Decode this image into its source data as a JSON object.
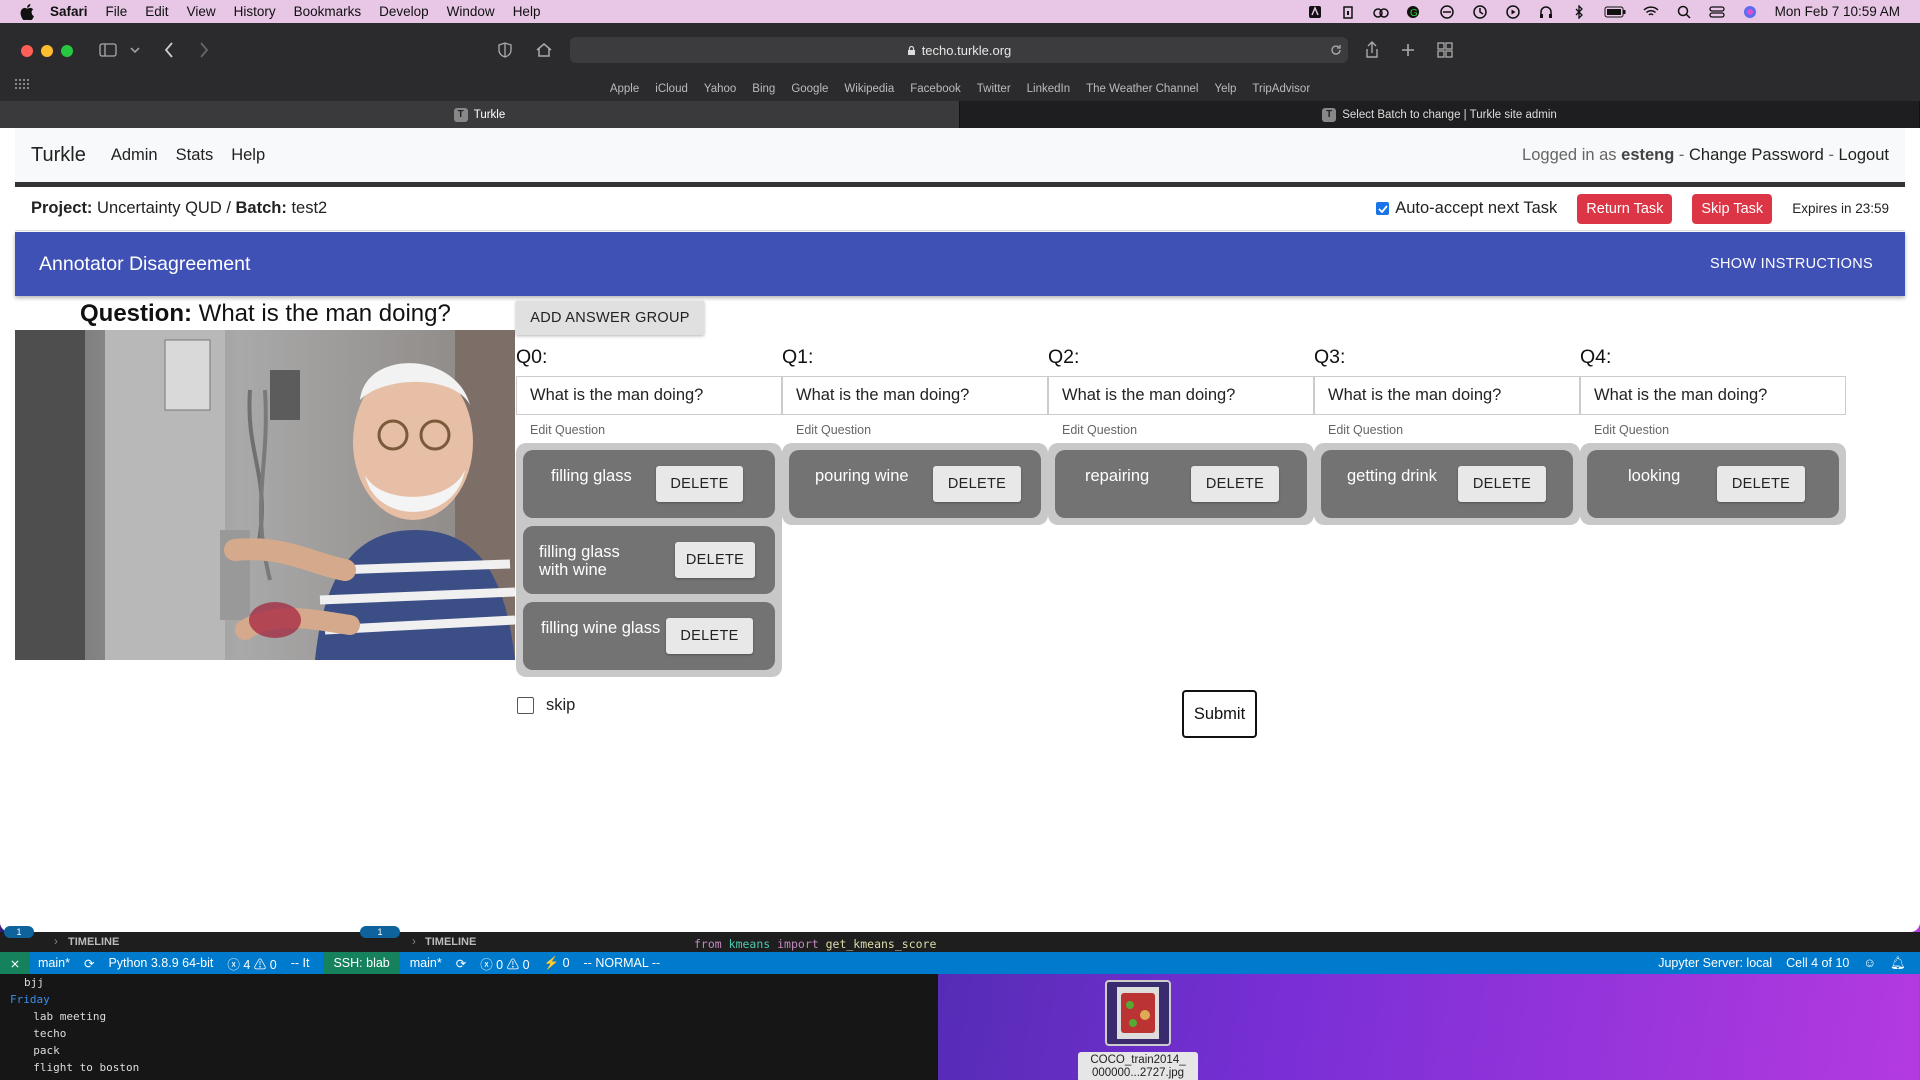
{
  "menubar": {
    "app": "Safari",
    "items": [
      "File",
      "Edit",
      "View",
      "History",
      "Bookmarks",
      "Develop",
      "Window",
      "Help"
    ],
    "datetime": "Mon Feb 7  10:59 AM"
  },
  "browser": {
    "url": "techo.turkle.org",
    "favorites": [
      "Apple",
      "iCloud",
      "Yahoo",
      "Bing",
      "Google",
      "Wikipedia",
      "Facebook",
      "Twitter",
      "LinkedIn",
      "The Weather Channel",
      "Yelp",
      "TripAdvisor"
    ],
    "tabs": [
      {
        "label": "Turkle",
        "favicon": "T"
      },
      {
        "label": "Select Batch to change | Turkle site admin",
        "favicon": "T"
      }
    ]
  },
  "nav": {
    "brand": "Turkle",
    "links": [
      "Admin",
      "Stats",
      "Help"
    ],
    "logged_in_prefix": "Logged in as",
    "username": "esteng",
    "sep": "-",
    "change_password": "Change Password",
    "logout": "Logout"
  },
  "project": {
    "project_label": "Project:",
    "project_name": "Uncertainty QUD",
    "slash": "/",
    "batch_label": "Batch:",
    "batch_name": "test2",
    "auto_accept": "Auto-accept next Task",
    "return_task": "Return Task",
    "skip_task": "Skip Task",
    "expires": "Expires in 23:59"
  },
  "header": {
    "title": "Annotator Disagreement",
    "show_instructions": "SHOW INSTRUCTIONS"
  },
  "task": {
    "question_label": "Question:",
    "question_text": "What is the man doing?",
    "add_answer_group": "ADD ANSWER GROUP",
    "edit_question": "Edit Question",
    "delete_label": "DELETE",
    "groups": [
      {
        "label": "Q0:",
        "question": "What is the man doing?",
        "answers": [
          "filling glass",
          "filling glass with wine",
          "filling wine glass"
        ]
      },
      {
        "label": "Q1:",
        "question": "What is the man doing?",
        "answers": [
          "pouring wine"
        ]
      },
      {
        "label": "Q2:",
        "question": "What is the man doing?",
        "answers": [
          "repairing"
        ]
      },
      {
        "label": "Q3:",
        "question": "What is the man doing?",
        "answers": [
          "getting drink"
        ]
      },
      {
        "label": "Q4:",
        "question": "What is the man doing?",
        "answers": [
          "looking"
        ]
      }
    ],
    "skip_label": "skip",
    "submit": "Submit"
  },
  "vscode": {
    "timeline": "TIMELINE",
    "code_line_from": "from",
    "code_line_module": "kmeans",
    "code_line_import": "import",
    "code_line_name": "get_kmeans_score",
    "status_left": [
      "main*",
      "Python 3.8.9 64-bit",
      "ⓧ 4 ⚠ 0",
      "-- It"
    ],
    "status_mid": [
      "SSH: blab",
      "main*",
      "ⓧ 0 ⚠ 0",
      "⚡ 0",
      "-- NORMAL --"
    ],
    "status_right": [
      "Jupyter Server: local",
      "Cell 4 of 10"
    ],
    "badge_count": "1"
  },
  "terminal": {
    "lines": [
      "bjj",
      "Friday",
      "  lab meeting",
      "  techo",
      "  pack",
      "  flight to boston"
    ]
  },
  "desktop": {
    "file_name_line1": "COCO_train2014_",
    "file_name_line2": "000000...2727.jpg"
  }
}
